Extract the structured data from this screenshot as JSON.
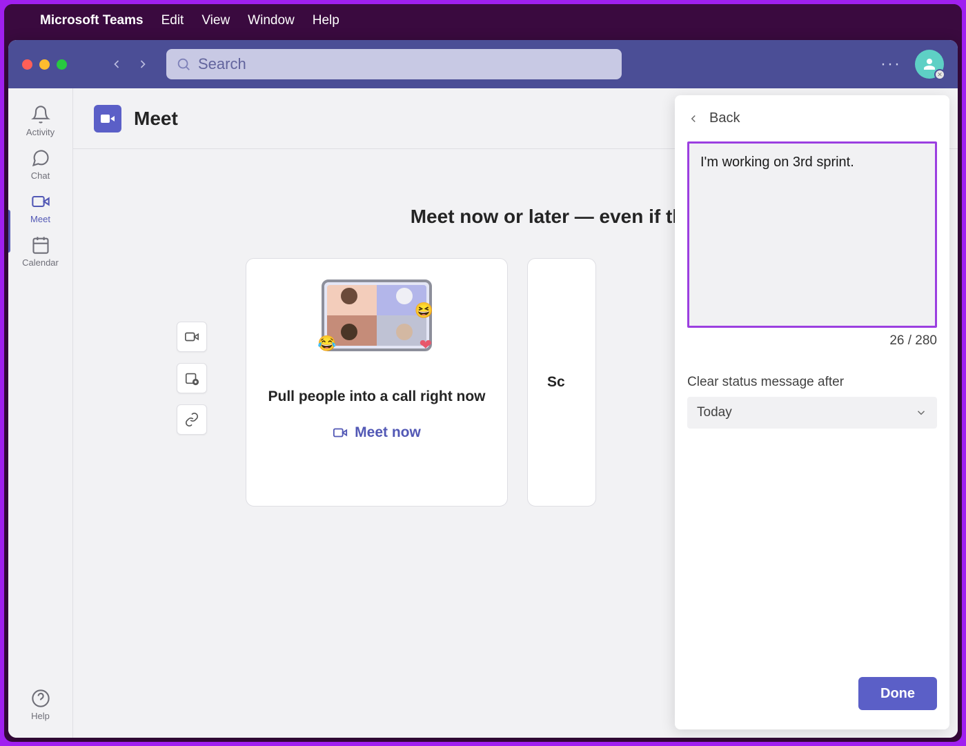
{
  "menubar": {
    "app_name": "Microsoft Teams",
    "items": [
      "Edit",
      "View",
      "Window",
      "Help"
    ]
  },
  "titlebar": {
    "search_placeholder": "Search"
  },
  "rail": {
    "activity": "Activity",
    "chat": "Chat",
    "meet": "Meet",
    "calendar": "Calendar",
    "help": "Help"
  },
  "main": {
    "title": "Meet",
    "headline": "Meet now or later — even if they'",
    "card1_text": "Pull people into a call right now",
    "card1_cta": "Meet now",
    "card2_peek": "Sc"
  },
  "panel": {
    "back_label": "Back",
    "status_value": "I'm working on 3rd sprint.",
    "counter": "26 / 280",
    "clear_label": "Clear status message after",
    "select_value": "Today",
    "done_label": "Done"
  }
}
